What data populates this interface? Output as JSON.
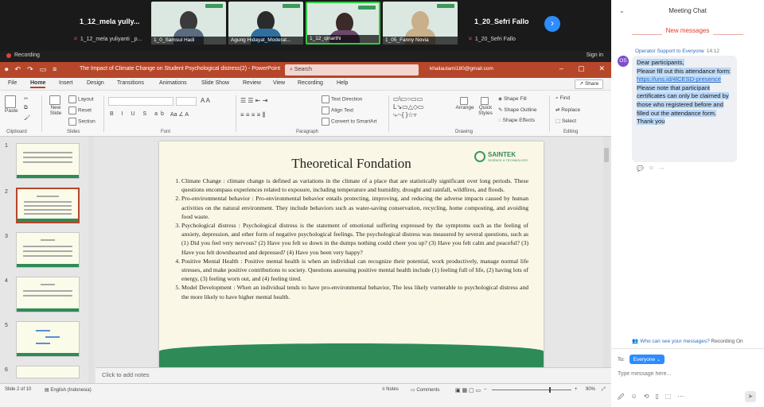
{
  "zoom": {
    "participants": [
      {
        "name": "1_12_mela yully...",
        "sub": "1_12_mela yuliyanti _p..."
      },
      {
        "video_label": "1_0_Samsul Hadi"
      },
      {
        "video_label": "Agung Hidayat_Moderat..."
      },
      {
        "video_label": "1_12_qinarthi"
      },
      {
        "video_label": "1_05_Fanny Novia"
      },
      {
        "name": "1_20_Sefri Fallo",
        "sub": "1_20_Sefri Fallo"
      }
    ],
    "recording": "Recording",
    "sign_in": "Sign in",
    "next_icon": "chevron-right-icon"
  },
  "ppt": {
    "doc_title": "The Impact of Climate Change on Student Psychological distress(2)  -  PowerPoint",
    "search_placeholder": "Search",
    "email": "khailautami180@gmail.com",
    "menu": [
      "File",
      "Home",
      "Insert",
      "Design",
      "Transitions",
      "Animations",
      "Slide Show",
      "Review",
      "View",
      "Recording",
      "Help"
    ],
    "share": "Share",
    "ribbon": {
      "paste": "Paste",
      "new_slide": "New Slide",
      "layout": "Layout",
      "reset": "Reset",
      "section": "Section",
      "clipboard": "Clipboard",
      "slides": "Slides",
      "font": "Font",
      "paragraph": "Paragraph",
      "drawing": "Drawing",
      "editing": "Editing",
      "text_direction": "Text Direction",
      "align_text": "Align Text",
      "convert_smartart": "Convert to SmartArt",
      "arrange": "Arrange",
      "quick_styles": "Quick Styles",
      "shape_fill": "Shape Fill",
      "shape_outline": "Shape Outline",
      "shape_effects": "Shape Effects",
      "find": "Find",
      "replace": "Replace",
      "select": "Select"
    },
    "slide": {
      "title": "Theoretical Fondation",
      "logo_main": "SAINTEK",
      "logo_sub": "SCIENCE & TECHNOLOGY",
      "items": [
        "Climate Change : climate change is defined as variations in the climate of a place that are statistically significant over long periods. These questions encompass experiences related to exposure, including temperature and humidity, drought and rainfall, wildfires, and floods.",
        "Pro-environmental behavior : Pro-environmental behavior entails protecting, improving, and reducing the adverse impacts caused by human activities on the natural environment. They include behaviors such as water-saving conservation, recycling, home composting, and avoiding food waste.",
        "Psychological distress : Psychological distress is the statement of emotional suffering expressed by the symptoms such as the feeling of anxiety, depression, and other form of negative psychological feelings. The psychological distress was measured by several questions, such as (1) Did you feel very nervous? (2) Have you felt so down in the dumps nothing could cheer you up? (3) Have you felt calm and peaceful? (3) Have you felt downhearted and depressed? (4) Have you been very happy?",
        "Positive Mental Health : Positive mental health is when an individual can recognize their potential, work productively, manage normal life stresses, and make positive contributions to society. Questions assessing positive mental health include (1) feeling full of life, (2) having lots of energy, (3) feeling worn out, and (4) feeling tired.",
        "Model Development : When an individual tends to have pro-environmental behavior, The less likely vurnerable to psychological distress and the more likely to have higher mental health."
      ]
    },
    "thumbnails": [
      "1",
      "2",
      "3",
      "4",
      "5",
      "6"
    ],
    "notes_placeholder": "Click to add notes",
    "status": {
      "slide_of": "Slide 2 of 10",
      "language": "English (Indonesia)",
      "notes": "Notes",
      "comments": "Comments",
      "zoom": "90%"
    }
  },
  "chat": {
    "title": "Meeting Chat",
    "new_messages": "New messages",
    "avatar": "OS",
    "sender": "Operator Support to Everyone",
    "time": "14:12",
    "msg_line1": "Dear participants,",
    "msg_line2": "Please fill out this attendance form: ",
    "msg_link": "https://uns.id/4lCESD-presence",
    "msg_line3": "Please note that participant certificates can only be claimed by those who registered before and filled out the attendance form.",
    "msg_line4": "Thank you",
    "who_can_see_prefix": "Who can see your messages?",
    "who_can_see_suffix": "Recording On",
    "to_label": "To:",
    "to_value": "Everyone",
    "input_placeholder": "Type message here..."
  }
}
